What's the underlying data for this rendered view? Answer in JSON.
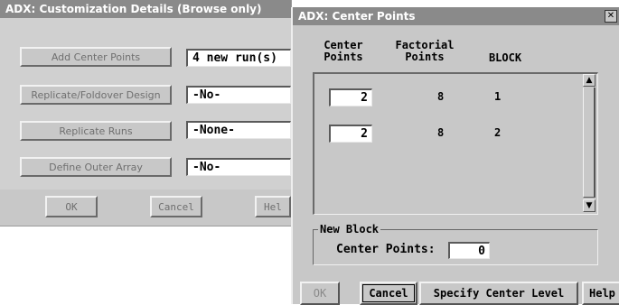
{
  "custom_window": {
    "title": "ADX: Customization Details (Browse only)",
    "rows": [
      {
        "button": "Add Center Points",
        "value": "4 new run(s)"
      },
      {
        "button": "Replicate/Foldover Design",
        "value": "-No-"
      },
      {
        "button": "Replicate Runs",
        "value": "-None-"
      },
      {
        "button": "Define Outer Array",
        "value": "-No-"
      }
    ],
    "ok_label": "OK",
    "cancel_label": "Cancel",
    "help_label": "Hel"
  },
  "center_window": {
    "title": "ADX: Center Points",
    "close_glyph": "✕",
    "headers": {
      "center_points": [
        "Center",
        "Points"
      ],
      "factorial_points": [
        "Factorial",
        "Points"
      ],
      "block": "BLOCK"
    },
    "table_rows": [
      {
        "center_points": "2",
        "factorial_points": "8",
        "block": "1"
      },
      {
        "center_points": "2",
        "factorial_points": "8",
        "block": "2"
      }
    ],
    "scroll_up_glyph": "▲",
    "scroll_down_glyph": "▼",
    "new_block_label": "New Block",
    "center_points_label": "Center Points:",
    "center_points_value": "0",
    "ok_label": "OK",
    "cancel_label": "Cancel",
    "specify_label": "Specify Center Level",
    "help_label": "Help"
  }
}
